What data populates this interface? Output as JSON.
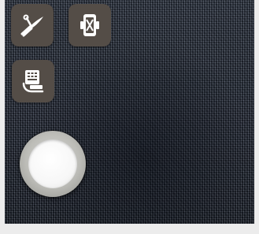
{
  "screen": {
    "viewfinder": "camera-preview-dark-fabric"
  },
  "toolbar": {
    "buttons": [
      {
        "id": "cutter",
        "icon": "wire-cutter-icon"
      },
      {
        "id": "phone",
        "icon": "phone-battery-icon"
      },
      {
        "id": "reader",
        "icon": "card-reader-icon"
      }
    ]
  },
  "capture": {
    "icon": "shutter-button"
  },
  "colors": {
    "button_bg": "#544d47",
    "icon_fg": "#ffffff",
    "viewfinder_bg": "#2a3140",
    "shutter_inner": "#f7f7f7",
    "shutter_ring": "#bcbcb7"
  }
}
